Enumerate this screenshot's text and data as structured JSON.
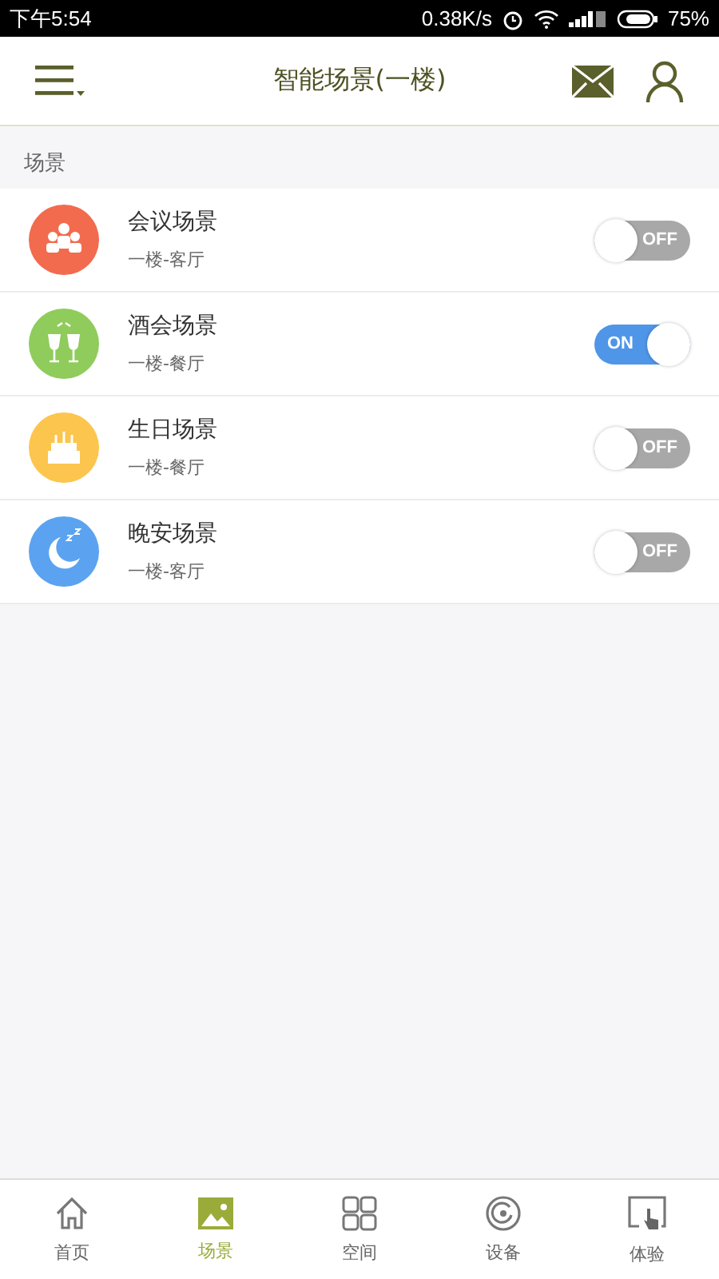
{
  "status_bar": {
    "time": "下午5:54",
    "speed": "0.38K/s",
    "battery": "75%"
  },
  "header": {
    "title": "智能场景(一楼)"
  },
  "section": {
    "title": "场景"
  },
  "scenes": [
    {
      "name": "会议场景",
      "location": "一楼-客厅",
      "kind": "meeting",
      "color": "#f26b4f",
      "on": false,
      "label": "OFF"
    },
    {
      "name": "酒会场景",
      "location": "一楼-餐厅",
      "kind": "party",
      "color": "#8fcc5c",
      "on": true,
      "label": "ON"
    },
    {
      "name": "生日场景",
      "location": "一楼-餐厅",
      "kind": "birthday",
      "color": "#fcc54d",
      "on": false,
      "label": "OFF"
    },
    {
      "name": "晚安场景",
      "location": "一楼-客厅",
      "kind": "night",
      "color": "#5ba3f0",
      "on": false,
      "label": "OFF"
    }
  ],
  "tabs": [
    {
      "label": "首页",
      "kind": "home",
      "selected": false
    },
    {
      "label": "场景",
      "kind": "scene",
      "selected": true
    },
    {
      "label": "空间",
      "kind": "space",
      "selected": false
    },
    {
      "label": "设备",
      "kind": "device",
      "selected": false
    },
    {
      "label": "体验",
      "kind": "experience",
      "selected": false
    }
  ]
}
